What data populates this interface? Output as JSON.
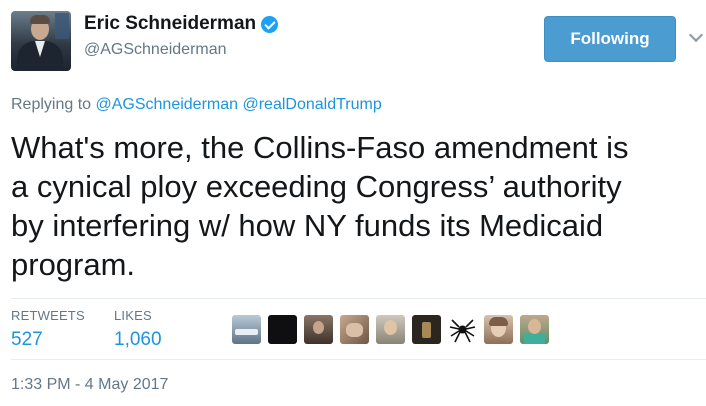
{
  "author": {
    "name": "Eric Schneiderman",
    "handle": "@AGSchneiderman",
    "verified": true
  },
  "follow_button": {
    "label": "Following"
  },
  "reply": {
    "prefix": "Replying to",
    "mentions": [
      "@AGSchneiderman",
      "@realDonaldTrump"
    ]
  },
  "tweet": {
    "lines": [
      "What's more, the Collins-Faso amendment is",
      "a cynical ploy exceeding Congress’ authority",
      "by interfering w/ how NY funds its Medicaid",
      "program."
    ]
  },
  "stats": {
    "retweets": {
      "label": "RETWEETS",
      "value": "527"
    },
    "likes": {
      "label": "LIKES",
      "value": "1,060"
    }
  },
  "likers": [
    {
      "name": "liker-avatar-1",
      "color": "#8da3b8"
    },
    {
      "name": "liker-avatar-2",
      "color": "#0f0f12"
    },
    {
      "name": "liker-avatar-3",
      "color": "#6b5a4e"
    },
    {
      "name": "liker-avatar-4",
      "color": "#9b7f6a"
    },
    {
      "name": "liker-avatar-5",
      "color": "#a8a194"
    },
    {
      "name": "liker-avatar-6",
      "color": "#2c2620"
    },
    {
      "name": "liker-avatar-7",
      "color": "#ffffff"
    },
    {
      "name": "liker-avatar-8",
      "color": "#c09a7e"
    },
    {
      "name": "liker-avatar-9",
      "color": "#7a9a6b"
    }
  ],
  "timestamp": "1:33 PM - 4 May 2017",
  "colors": {
    "link": "#1b95e0",
    "follow_button": "#4a9cd1",
    "muted": "#657786"
  }
}
